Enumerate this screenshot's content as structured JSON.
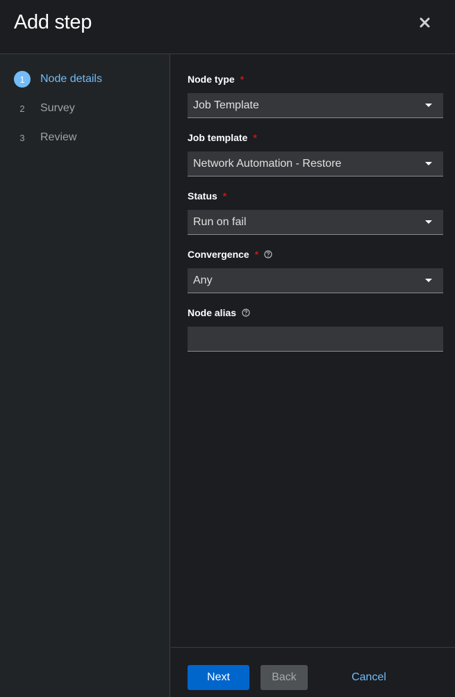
{
  "header": {
    "title": "Add step",
    "close_icon": "close-icon"
  },
  "nav": {
    "items": [
      {
        "number": "1",
        "label": "Node details",
        "active": true
      },
      {
        "number": "2",
        "label": "Survey",
        "active": false
      },
      {
        "number": "3",
        "label": "Review",
        "active": false
      }
    ]
  },
  "form": {
    "node_type": {
      "label": "Node type",
      "required": "*",
      "value": "Job Template"
    },
    "job_template": {
      "label": "Job template",
      "required": "*",
      "value": "Network Automation - Restore"
    },
    "status": {
      "label": "Status",
      "required": "*",
      "value": "Run on fail"
    },
    "convergence": {
      "label": "Convergence",
      "required": "*",
      "value": "Any"
    },
    "node_alias": {
      "label": "Node alias",
      "value": "",
      "placeholder": ""
    }
  },
  "footer": {
    "next_label": "Next",
    "back_label": "Back",
    "cancel_label": "Cancel"
  },
  "colors": {
    "accent": "#73bcf7",
    "primary_button": "#0066cc",
    "required": "#c9190b",
    "background": "#1b1d21",
    "nav_background": "#212427"
  }
}
